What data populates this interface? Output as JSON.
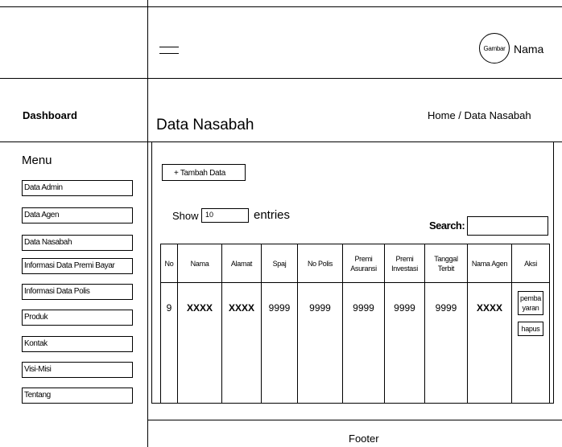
{
  "header": {
    "avatar_label": "Gambar",
    "user_name": "Nama"
  },
  "sidebar": {
    "dashboard_label": "Dashboard",
    "menu_title": "Menu",
    "items": [
      {
        "label": "Data Admin"
      },
      {
        "label": "Data Agen"
      },
      {
        "label": "Data Nasabah"
      },
      {
        "label": "Informasi Data Premi Bayar"
      },
      {
        "label": "Informasi Data Polis"
      },
      {
        "label": "Produk"
      },
      {
        "label": "Kontak"
      },
      {
        "label": "Visi-Misi"
      },
      {
        "label": "Tentang"
      }
    ]
  },
  "main": {
    "page_title": "Data Nasabah",
    "breadcrumb": "Home / Data Nasabah",
    "add_button_label": "+ Tambah Data",
    "show_label": "Show",
    "entries_value": "10",
    "entries_label": "entries",
    "search_label": "Search:",
    "search_value": "",
    "table": {
      "columns": [
        "No",
        "Nama",
        "Alamat",
        "Spaj",
        "No Polis",
        "Premi Asuransi",
        "Premi Investasi",
        "Tanggal Terbit",
        "Nama Agen",
        "Aksi"
      ],
      "rows": [
        {
          "cells": [
            "9",
            "XXXX",
            "XXXX",
            "9999",
            "9999",
            "9999",
            "9999",
            "9999",
            "XXXX"
          ],
          "actions": [
            "pembayaran",
            "hapus"
          ]
        }
      ]
    }
  },
  "footer": {
    "label": "Footer"
  }
}
